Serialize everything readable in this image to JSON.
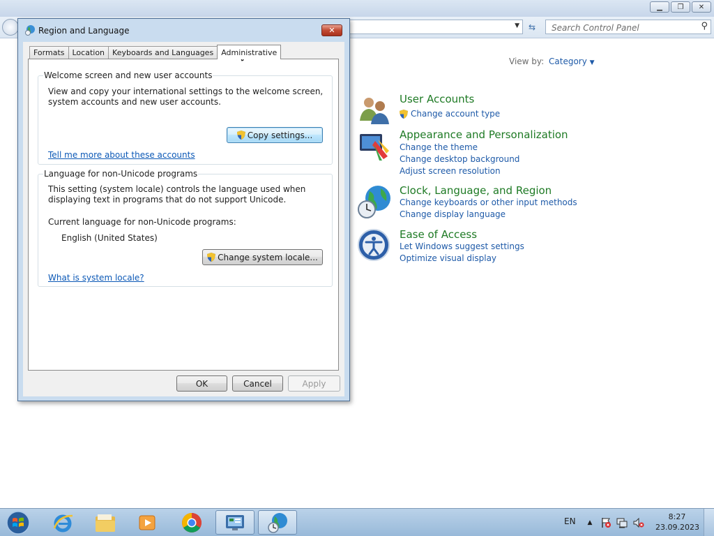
{
  "control_panel": {
    "search_placeholder": "Search Control Panel",
    "view_by_label": "View by:",
    "view_by_value": "Category",
    "categories": [
      {
        "title": "User Accounts",
        "links": [
          "Change account type"
        ]
      },
      {
        "title": "Appearance and Personalization",
        "links": [
          "Change the theme",
          "Change desktop background",
          "Adjust screen resolution"
        ]
      },
      {
        "title": "Clock, Language, and Region",
        "links": [
          "Change keyboards or other input methods",
          "Change display language"
        ]
      },
      {
        "title": "Ease of Access",
        "links": [
          "Let Windows suggest settings",
          "Optimize visual display"
        ]
      }
    ]
  },
  "dialog": {
    "title": "Region and Language",
    "tabs": [
      "Formats",
      "Location",
      "Keyboards and Languages",
      "Administrative"
    ],
    "active_tab": "Administrative",
    "welcome_group": {
      "title": "Welcome screen and new user accounts",
      "description": "View and copy your international settings to the welcome screen, system accounts and new user accounts.",
      "button": "Copy settings...",
      "link": "Tell me more about these accounts"
    },
    "locale_group": {
      "title": "Language for non-Unicode programs",
      "description": "This setting (system locale) controls the language used when displaying text in programs that do not support Unicode.",
      "current_label": "Current language for non-Unicode programs:",
      "current_value": "English (United States)",
      "button": "Change system locale...",
      "link": "What is system locale?"
    },
    "buttons": {
      "ok": "OK",
      "cancel": "Cancel",
      "apply": "Apply"
    }
  },
  "taskbar": {
    "language": "EN",
    "time": "8:27",
    "date": "23.09.2023"
  }
}
